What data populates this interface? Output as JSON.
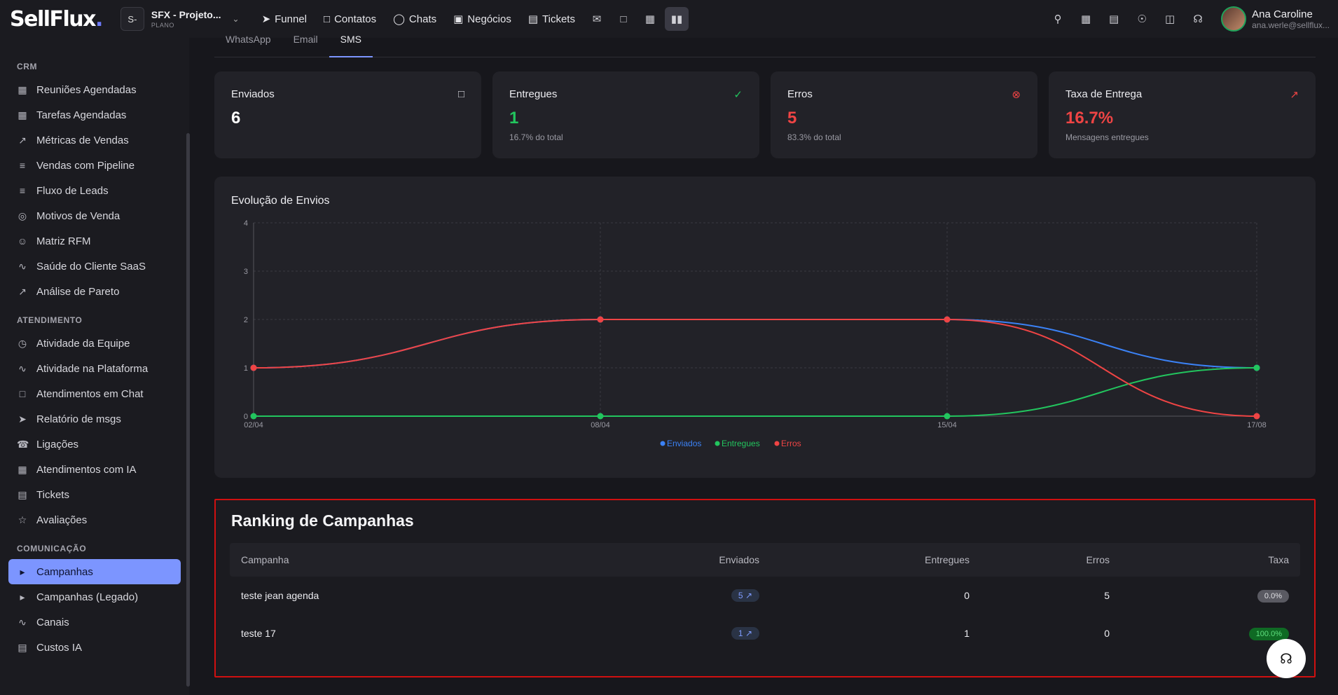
{
  "header": {
    "logo": "SellFlux",
    "logo_dot": ".",
    "workspace_badge": "S-",
    "workspace_name": "SFX - Projeto...",
    "workspace_plan": "PLANO",
    "nav": [
      {
        "label": "Funnel",
        "icon": "rocket-icon"
      },
      {
        "label": "Contatos",
        "icon": "contacts-icon"
      },
      {
        "label": "Chats",
        "icon": "chat-icon"
      },
      {
        "label": "Negócios",
        "icon": "briefcase-icon"
      },
      {
        "label": "Tickets",
        "icon": "ticket-icon"
      }
    ],
    "user_name": "Ana Caroline",
    "user_email": "ana.werle@sellflux..."
  },
  "sidebar": {
    "sections": [
      {
        "title": "CRM",
        "items": [
          "Reuniões Agendadas",
          "Tarefas Agendadas",
          "Métricas de Vendas",
          "Vendas com Pipeline",
          "Fluxo de Leads",
          "Motivos de Venda",
          "Matriz RFM",
          "Saúde do Cliente SaaS",
          "Análise de Pareto"
        ]
      },
      {
        "title": "ATENDIMENTO",
        "items": [
          "Atividade da Equipe",
          "Atividade na Plataforma",
          "Atendimentos em Chat",
          "Relatório de msgs",
          "Ligações",
          "Atendimentos com IA",
          "Tickets",
          "Avaliações"
        ]
      },
      {
        "title": "COMUNICAÇÃO",
        "items": [
          "Campanhas",
          "Campanhas (Legado)",
          "Canais",
          "Custos IA"
        ]
      }
    ],
    "active_item": "Campanhas"
  },
  "tabs": [
    "WhatsApp",
    "Email",
    "SMS"
  ],
  "active_tab": "SMS",
  "cards": [
    {
      "title": "Enviados",
      "value": "6",
      "sub": "",
      "color": "#ffffff",
      "icon": "message-icon",
      "icon_color": "#d8d8de"
    },
    {
      "title": "Entregues",
      "value": "1",
      "sub": "16.7% do total",
      "color": "#22c55e",
      "icon": "check-circle-icon",
      "icon_color": "#22c55e"
    },
    {
      "title": "Erros",
      "value": "5",
      "sub": "83.3% do total",
      "color": "#ef4444",
      "icon": "x-circle-icon",
      "icon_color": "#ef4444"
    },
    {
      "title": "Taxa de Entrega",
      "value": "16.7%",
      "sub": "Mensagens entregues",
      "color": "#ef4444",
      "icon": "trending-up-icon",
      "icon_color": "#ef4444"
    }
  ],
  "chart_data": {
    "type": "line",
    "title": "Evolução de Envios",
    "categories": [
      "02/04",
      "08/04",
      "15/04",
      "17/08"
    ],
    "series": [
      {
        "name": "Enviados",
        "color": "#3b82f6",
        "values": [
          1,
          2,
          2,
          1
        ]
      },
      {
        "name": "Entregues",
        "color": "#22c55e",
        "values": [
          0,
          0,
          0,
          1
        ]
      },
      {
        "name": "Erros",
        "color": "#ef4444",
        "values": [
          1,
          2,
          2,
          0
        ]
      }
    ],
    "ylim": [
      0,
      4
    ],
    "yticks": [
      0,
      1,
      2,
      3,
      4
    ],
    "grid": true,
    "legend": "bottom-center"
  },
  "ranking": {
    "title": "Ranking de Campanhas",
    "columns": [
      "Campanha",
      "Enviados",
      "Entregues",
      "Erros",
      "Taxa"
    ],
    "rows": [
      {
        "name": "teste jean agenda",
        "enviados": "5",
        "entregues": "0",
        "erros": "5",
        "taxa": "0.0%",
        "taxa_style": "gray"
      },
      {
        "name": "teste 17",
        "enviados": "1",
        "entregues": "1",
        "erros": "0",
        "taxa": "100.0%",
        "taxa_style": "green"
      }
    ]
  }
}
